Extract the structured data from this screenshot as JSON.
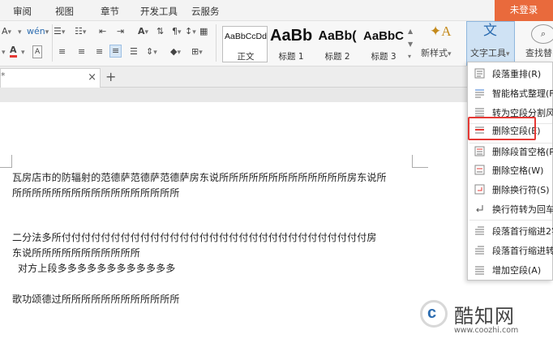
{
  "menu": {
    "items": [
      "审阅",
      "视图",
      "章节",
      "开发工具",
      "云服务"
    ],
    "login_label": "未登录"
  },
  "ribbon": {
    "styles": [
      {
        "preview": "AaBbCcDd",
        "name": "正文"
      },
      {
        "preview": "AaBb",
        "name": "标题 1"
      },
      {
        "preview": "AaBb(",
        "name": "标题 2"
      },
      {
        "preview": "AaBbC",
        "name": "标题 3"
      }
    ],
    "new_style_label": "新样式",
    "word_tools_label": "文字工具",
    "find_replace_label": "查找替"
  },
  "tabs": {
    "close_symbol": "×",
    "add_symbol": "+"
  },
  "document": {
    "lines": [
      "瓦房店市的防辐射的范德萨范德萨范德萨房东说所所所所所所所所所所所所所房东说所",
      "所所所所所所所所所所所所所所所所所",
      "",
      "",
      "二分法多所付付付付付付付付付付付付付付付付付付付付付付付付付付付付付付付房",
      "东说所所所所所所所所所所所",
      "对方上段多多多多多多多多多多多多",
      "",
      "歌功颂德过所所所所所所所所所所所所"
    ]
  },
  "dropdown": {
    "items": [
      {
        "label": "段落重排(R)",
        "icon": "paragraph-rearrange-icon"
      },
      {
        "label": "智能格式整理(F)",
        "icon": "smart-format-icon"
      },
      {
        "label": "转为空段分割风格",
        "icon": "empty-paragraph-split-icon"
      },
      {
        "label": "删除空段(E)",
        "icon": "delete-empty-paragraph-icon"
      },
      {
        "label": "删除段首空格(P)",
        "icon": "delete-leading-spaces-icon"
      },
      {
        "label": "删除空格(W)",
        "icon": "delete-spaces-icon"
      },
      {
        "label": "删除换行符(S)",
        "icon": "delete-line-breaks-icon"
      },
      {
        "label": "换行符转为回车(",
        "icon": "line-break-to-return-icon"
      },
      {
        "label": "段落首行缩进2字",
        "icon": "first-line-indent-icon"
      },
      {
        "label": "段落首行缩进转为",
        "icon": "indent-convert-icon"
      },
      {
        "label": "增加空段(A)",
        "icon": "add-empty-paragraph-icon"
      }
    ]
  },
  "watermark": {
    "name": "酷知网",
    "url": "www.coozhi.com"
  },
  "colors": {
    "login_bg": "#e96a3c",
    "highlight": "#e53935",
    "active_tool_bg": "#cfe2f4"
  }
}
